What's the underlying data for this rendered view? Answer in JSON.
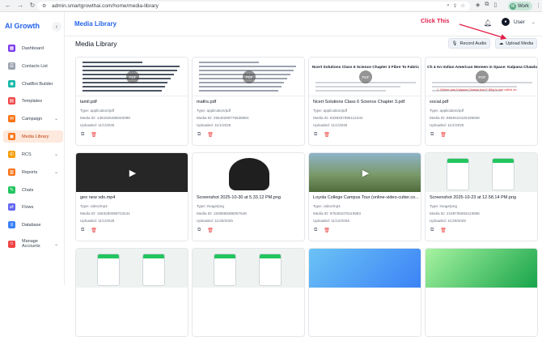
{
  "browser": {
    "url": "admin.smartgrowthai.com/home/media-library",
    "profile": "Work"
  },
  "sidebar": {
    "brand": "AI Growth",
    "items": [
      {
        "label": "Dashboard",
        "icon": "dashboard-icon",
        "color": "#7c3aed"
      },
      {
        "label": "Contacts List",
        "icon": "contacts-icon",
        "color": "#9ca3af"
      },
      {
        "label": "ChatBot Builder",
        "icon": "chatbot-icon",
        "color": "#14b8a6"
      },
      {
        "label": "Templates",
        "icon": "templates-icon",
        "color": "#ef4444"
      },
      {
        "label": "Campaign",
        "icon": "campaign-icon",
        "color": "#f97316",
        "chevron": "⌄"
      },
      {
        "label": "Media Library",
        "icon": "media-icon",
        "color": "#f97316",
        "active": true
      },
      {
        "label": "RCS",
        "icon": "rcs-icon",
        "color": "#f59e0b",
        "chevron": "⌄"
      },
      {
        "label": "Reports",
        "icon": "reports-icon",
        "color": "#f97316",
        "chevron": "⌄"
      },
      {
        "label": "Chats",
        "icon": "chats-icon",
        "color": "#22c55e"
      },
      {
        "label": "Flows",
        "icon": "flows-icon",
        "color": "#6366f1"
      },
      {
        "label": "Database",
        "icon": "database-icon",
        "color": "#3b82f6"
      },
      {
        "label": "Manage Accounts",
        "icon": "accounts-icon",
        "color": "#ef4444",
        "chevron": "⌄"
      }
    ]
  },
  "header": {
    "title": "Media Library",
    "annotation": "Click This",
    "user": "User"
  },
  "main": {
    "title": "Media Library",
    "record_label": "Record Audio",
    "upload_label": "Upload Media",
    "cards": [
      {
        "name": "tamil.pdf",
        "type": "Type: application/pdf",
        "media_id": "Media ID: 1361826485040089",
        "uploaded": "Uploaded: 11/1/2025",
        "kind": "pdf",
        "badge": "PDF"
      },
      {
        "name": "maths.pdf",
        "type": "Type: application/pdf",
        "media_id": "Media ID: 2554026977663586C",
        "uploaded": "Uploaded: 11/1/2025",
        "kind": "pdf",
        "badge": "PDF"
      },
      {
        "name": "Ncert Solutions Class 6 Science Chapter 3.pdf",
        "type": "Type: application/pdf",
        "media_id": "Media ID: 8339457695112444",
        "uploaded": "Uploaded: 11/1/2025",
        "kind": "pdf",
        "badge": "PDF",
        "heading": "Ncert Solutions Class 6 Science Chapter 3 Fibre To Fabric"
      },
      {
        "name": "social.pdf",
        "type": "Type: application/pdf",
        "media_id": "Media ID: 8669424420435606",
        "uploaded": "Uploaded: 11/1/2025",
        "kind": "pdf",
        "badge": "PDF",
        "heading": "Ch 4 An Indian American Women in Space: Kalpana Chawla",
        "red": "1. Where was Kalpana Chawla born? Why is she called an"
      },
      {
        "name": "geo new vdo.mp4",
        "type": "Type: video/mp4",
        "media_id": "Media ID: 1583280069723441",
        "uploaded": "Uploaded: 11/1/2025",
        "kind": "video"
      },
      {
        "name": "Screenshot 2025-10-30 at 5.33.12 PM.png",
        "type": "Type: image/png",
        "media_id": "Media ID: 1539869386057549",
        "uploaded": "Uploaded: 11/30/2025",
        "kind": "image"
      },
      {
        "name": "Loyola College Campus Tour (online-video-cutter.co...",
        "type": "Type: video/mp4",
        "media_id": "Media ID: 875391076110963",
        "uploaded": "Uploaded: 11/12/2025",
        "kind": "video"
      },
      {
        "name": "Screenshot 2025-10-23 at 12.58.14 PM.png",
        "type": "Type: image/png",
        "media_id": "Media ID: 2108735693123996",
        "uploaded": "Uploaded: 11/29/2025",
        "kind": "image"
      },
      {
        "name": "",
        "type": "",
        "media_id": "",
        "uploaded": "",
        "kind": "image"
      },
      {
        "name": "",
        "type": "",
        "media_id": "",
        "uploaded": "",
        "kind": "image"
      },
      {
        "name": "",
        "type": "",
        "media_id": "",
        "uploaded": "",
        "kind": "image"
      },
      {
        "name": "",
        "type": "",
        "media_id": "",
        "uploaded": "",
        "kind": "image"
      }
    ]
  },
  "colors": {
    "accent": "#2563eb",
    "active_bg": "#fde9dd",
    "annotation": "#e11d48"
  }
}
